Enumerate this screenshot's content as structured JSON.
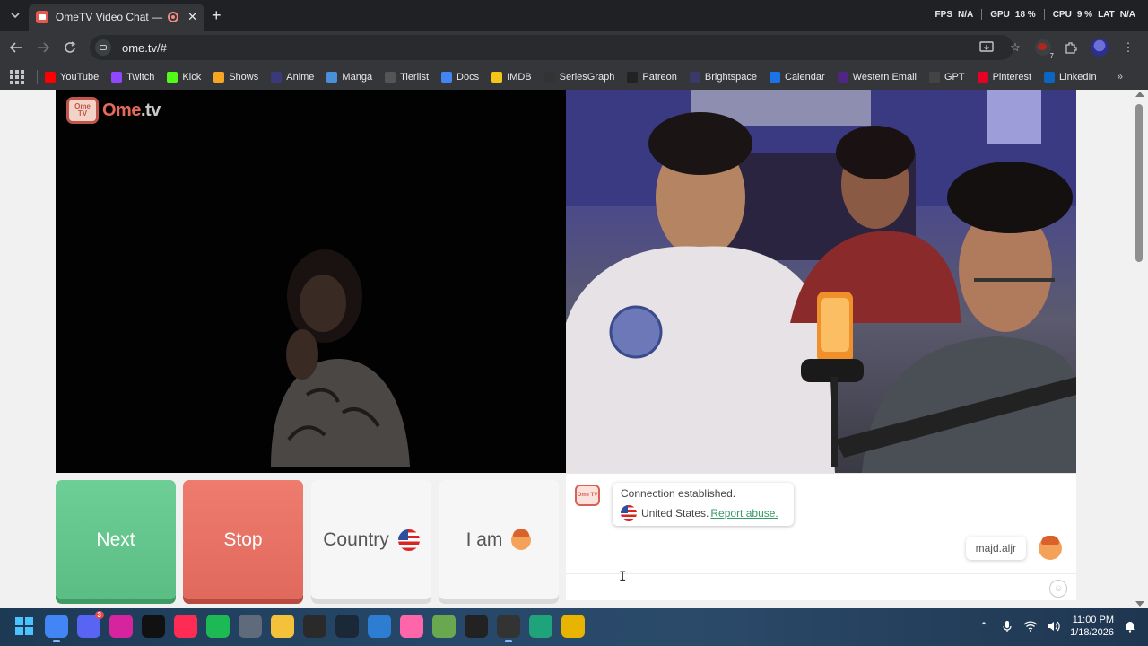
{
  "browser": {
    "tab": {
      "title": "OmeTV Video Chat — Ome"
    },
    "perf": {
      "fps_label": "FPS",
      "fps_value": "N/A",
      "gpu_label": "GPU",
      "gpu_value": "18 %",
      "cpu_label": "CPU",
      "cpu_value": "9 %",
      "lat_label": "LAT",
      "lat_value": "N/A"
    },
    "url": "ome.tv/#",
    "extension_badge_count": "7",
    "bookmarks": [
      {
        "label": "YouTube",
        "icon": "youtube-icon",
        "color": "#ff0000"
      },
      {
        "label": "Twitch",
        "icon": "twitch-icon",
        "color": "#9146ff"
      },
      {
        "label": "Kick",
        "icon": "kick-icon",
        "color": "#53fc18"
      },
      {
        "label": "Shows",
        "icon": "hd-icon",
        "color": "#f5a623"
      },
      {
        "label": "Anime",
        "icon": "anime-icon",
        "color": "#3a3a7a"
      },
      {
        "label": "Manga",
        "icon": "manga-icon",
        "color": "#4a90d9"
      },
      {
        "label": "Tierlist",
        "icon": "tierlist-icon",
        "color": "#555555"
      },
      {
        "label": "Docs",
        "icon": "docs-icon",
        "color": "#4285f4"
      },
      {
        "label": "IMDB",
        "icon": "imdb-icon",
        "color": "#f5c518"
      },
      {
        "label": "SeriesGraph",
        "icon": "seriesgraph-icon",
        "color": "#333333"
      },
      {
        "label": "Patreon",
        "icon": "patreon-icon",
        "color": "#222222"
      },
      {
        "label": "Brightspace",
        "icon": "brightspace-icon",
        "color": "#3a3a6a"
      },
      {
        "label": "Calendar",
        "icon": "calendar-icon",
        "color": "#1a73e8"
      },
      {
        "label": "Western Email",
        "icon": "western-email-icon",
        "color": "#4f2683"
      },
      {
        "label": "GPT",
        "icon": "gpt-icon",
        "color": "#444444"
      },
      {
        "label": "Pinterest",
        "icon": "pinterest-icon",
        "color": "#e60023"
      },
      {
        "label": "LinkedIn",
        "icon": "linkedin-icon",
        "color": "#0a66c2"
      }
    ]
  },
  "ometv": {
    "logo_text_a": "Ome",
    "logo_text_b": ".tv",
    "logo_badge": "Ome TV",
    "buttons": {
      "next": "Next",
      "stop": "Stop",
      "country": "Country",
      "iam": "I am"
    },
    "chat": {
      "bot_badge": "Ome TV",
      "system_line1": "Connection established.",
      "country": "United States.",
      "report": "Report abuse.",
      "user_message": "majd.aljr",
      "input_placeholder": ""
    }
  },
  "taskbar": {
    "time": "11:00 PM",
    "date": "1/18/2026",
    "discord_badge": "3",
    "apps": [
      {
        "name": "chrome-icon",
        "color": "#4285f4",
        "active": true
      },
      {
        "name": "discord-icon",
        "color": "#5865f2",
        "active": false
      },
      {
        "name": "instagram-icon",
        "color": "#d6249f",
        "active": false
      },
      {
        "name": "tiktok-icon",
        "color": "#111111",
        "active": false
      },
      {
        "name": "tiktok-studio-icon",
        "color": "#fe2c55",
        "active": false
      },
      {
        "name": "spotify-icon",
        "color": "#1db954",
        "active": false
      },
      {
        "name": "settings-icon",
        "color": "#5f6b7a",
        "active": false
      },
      {
        "name": "file-explorer-icon",
        "color": "#f3c13a",
        "active": false
      },
      {
        "name": "epic-games-icon",
        "color": "#2a2a2a",
        "active": false
      },
      {
        "name": "steam-icon",
        "color": "#1b2838",
        "active": false
      },
      {
        "name": "app-blue-icon",
        "color": "#2d7dd2",
        "active": false
      },
      {
        "name": "osu-icon",
        "color": "#ff66aa",
        "active": false
      },
      {
        "name": "app-layers-icon",
        "color": "#6aa84f",
        "active": false
      },
      {
        "name": "capcut-mask-icon",
        "color": "#222222",
        "active": false
      },
      {
        "name": "capcut-icon",
        "color": "#333333",
        "active": true
      },
      {
        "name": "app-green-icon",
        "color": "#1fa37a",
        "active": false
      },
      {
        "name": "app-circle-icon",
        "color": "#e8b400",
        "active": false
      }
    ]
  }
}
